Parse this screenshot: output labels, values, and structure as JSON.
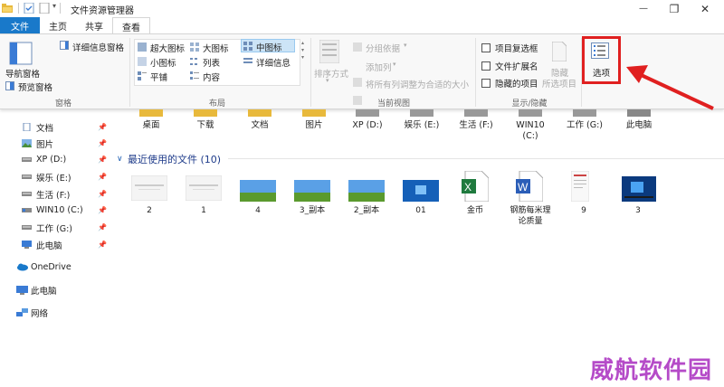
{
  "window": {
    "title": "文件资源管理器",
    "minimize": "—",
    "maximize": "❐",
    "close": "✕"
  },
  "tabs": {
    "file": "文件",
    "home": "主页",
    "share": "共享",
    "view": "查看"
  },
  "ribbon": {
    "panes": {
      "label": "窗格",
      "nav_pane": "导航窗格",
      "preview_pane": "预览窗格",
      "details_pane": "详细信息窗格"
    },
    "layout": {
      "label": "布局",
      "extra_large_icons": "超大图标",
      "large_icons": "大图标",
      "medium_icons": "中图标",
      "small_icons": "小图标",
      "list": "列表",
      "details": "详细信息",
      "tiles": "平铺",
      "content": "内容"
    },
    "current_view": {
      "label": "当前视图",
      "sort_by": "排序方式",
      "group_by": "分组依据",
      "add_columns": "添加列",
      "size_all_columns": "将所有列调整为合适的大小"
    },
    "show_hide": {
      "label": "显示/隐藏",
      "item_checkboxes": "项目复选框",
      "file_extensions": "文件扩展名",
      "hidden_items": "隐藏的项目",
      "hide_selected_1": "隐藏",
      "hide_selected_2": "所选项目"
    },
    "options": "选项"
  },
  "nav": {
    "items": [
      {
        "label": "文档",
        "pinned": true
      },
      {
        "label": "图片",
        "pinned": true
      },
      {
        "label": "XP (D:)",
        "pinned": true
      },
      {
        "label": "娱乐 (E:)",
        "pinned": true
      },
      {
        "label": "生活 (F:)",
        "pinned": true
      },
      {
        "label": "WIN10 (C:)",
        "pinned": true
      },
      {
        "label": "工作 (G:)",
        "pinned": true
      },
      {
        "label": "此电脑",
        "pinned": true
      }
    ],
    "onedrive": "OneDrive",
    "thispc": "此电脑",
    "network": "网络"
  },
  "frequent_folders": [
    "桌面",
    "下载",
    "文档",
    "图片",
    "XP (D:)",
    "娱乐 (E:)",
    "生活 (F:)",
    "WIN10\n(C:)",
    "工作 (G:)",
    "此电脑"
  ],
  "recent": {
    "header": "最近使用的文件 (10)",
    "files": [
      "2",
      "1",
      "4",
      "3_副本",
      "2_副本",
      "01",
      "金币",
      "钢筋每米理论质量",
      "9",
      "3"
    ]
  },
  "watermark": "威航软件园",
  "colors": {
    "accent": "#1979ca",
    "highlight_box": "#e02020",
    "arrow": "#e02020",
    "watermark": "#b54bc8"
  }
}
